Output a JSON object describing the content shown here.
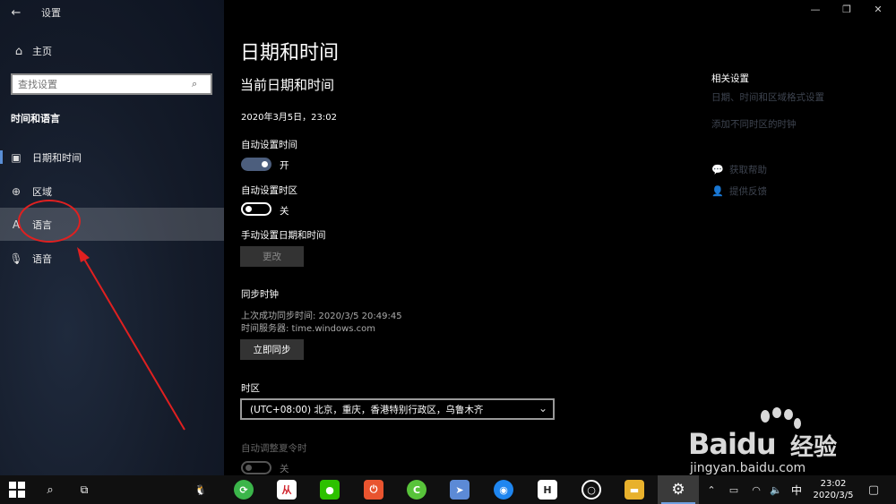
{
  "window": {
    "app_title": "设置",
    "back_icon": "back-arrow-icon",
    "controls": [
      "minimize-icon",
      "restore-icon",
      "close-icon"
    ]
  },
  "sidebar": {
    "home_label": "主页",
    "search_placeholder": "查找设置",
    "section_title": "时间和语言",
    "items": [
      {
        "label": "日期和时间",
        "icon": "calendar-clock-icon"
      },
      {
        "label": "区域",
        "icon": "globe-region-icon"
      },
      {
        "label": "语言",
        "icon": "language-icon"
      },
      {
        "label": "语音",
        "icon": "microphone-icon"
      }
    ],
    "selected_index": 0,
    "hovered_index": 2
  },
  "main": {
    "page_title": "日期和时间",
    "current_heading": "当前日期和时间",
    "current_datetime": "2020年3月5日，23:02",
    "auto_time": {
      "label": "自动设置时间",
      "state": "开"
    },
    "auto_zone": {
      "label": "自动设置时区",
      "state": "关"
    },
    "manual": {
      "label": "手动设置日期和时间",
      "button": "更改"
    },
    "sync": {
      "label": "同步时钟",
      "last_sync": "上次成功同步时间: 2020/3/5 20:49:45",
      "server": "时间服务器: time.windows.com",
      "button": "立即同步"
    },
    "timezone": {
      "label": "时区",
      "value": "(UTC+08:00) 北京，重庆，香港特别行政区，乌鲁木齐"
    },
    "dst": {
      "label": "自动调整夏令时",
      "state": "关"
    }
  },
  "related": {
    "title": "相关设置",
    "links": [
      "日期、时间和区域格式设置",
      "添加不同时区的时钟"
    ],
    "help": {
      "label": "获取帮助",
      "icon": "help-chat-icon"
    },
    "feedback": {
      "label": "提供反馈",
      "icon": "feedback-icon"
    }
  },
  "watermark": {
    "logo": "Bai",
    "logo2": "du",
    "text": "经验",
    "url": "jingyan.baidu.com"
  },
  "taskbar": {
    "ime": "中",
    "time": "23:02",
    "date": "2020/3/5",
    "colors": {
      "accent": "#6fa0e0"
    }
  }
}
